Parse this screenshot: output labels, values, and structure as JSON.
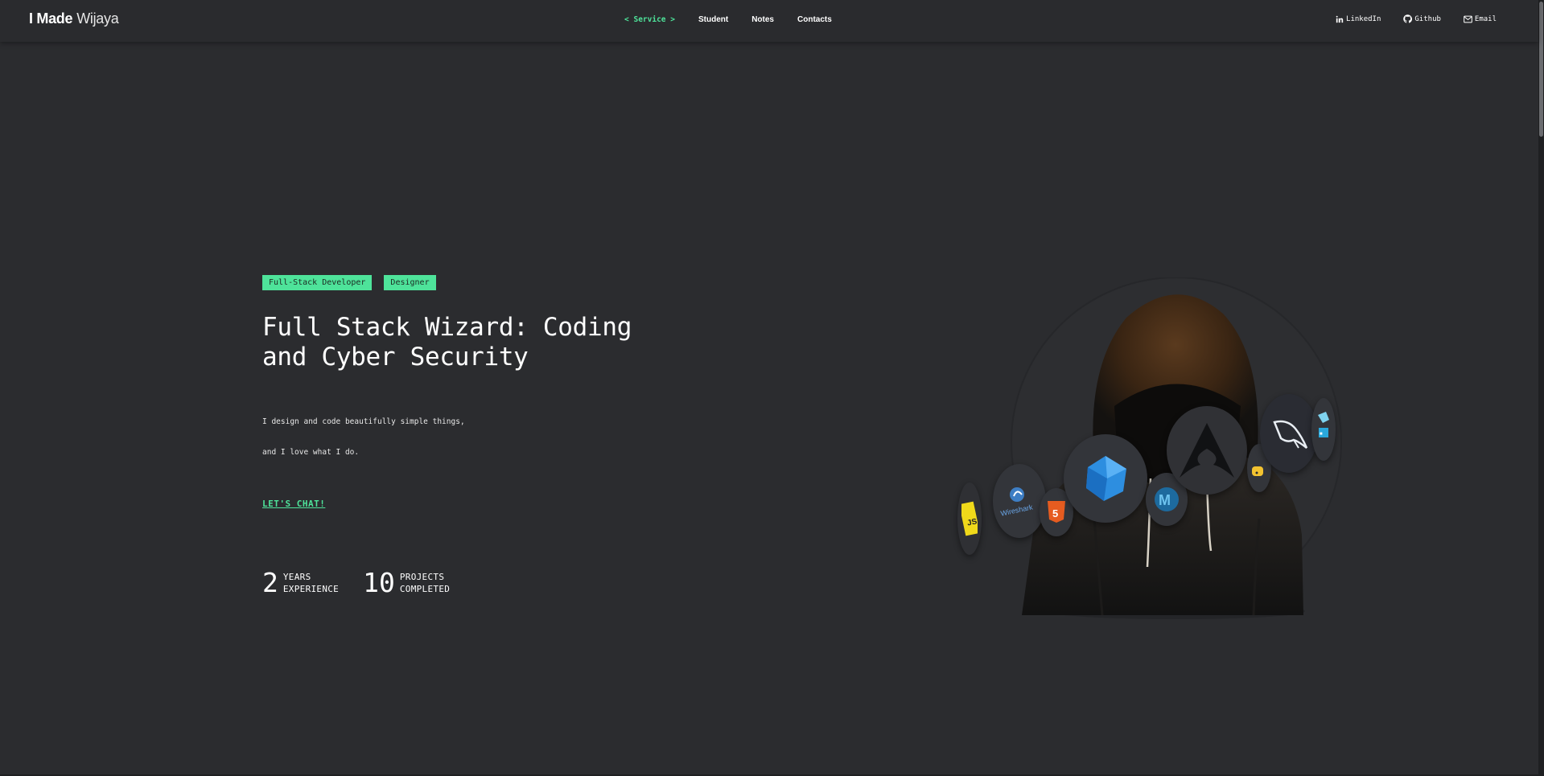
{
  "brand": {
    "first": "I Made",
    "last": "Wijaya"
  },
  "nav": {
    "active": {
      "prefix": "<",
      "label": "Service",
      "suffix": ">"
    },
    "links": [
      "Student",
      "Notes",
      "Contacts"
    ]
  },
  "social": [
    {
      "label": "LinkedIn",
      "icon": "linkedin-icon"
    },
    {
      "label": "Github",
      "icon": "github-icon"
    },
    {
      "label": "Email",
      "icon": "email-icon"
    }
  ],
  "hero": {
    "tags": [
      "Full-Stack Developer",
      "Designer"
    ],
    "title": "Full Stack Wizard: Coding and Cyber Security",
    "description_line1": "I design and code beautifully simple things,",
    "description_line2": "and I love what I do.",
    "cta": "LET'S CHAT!",
    "stats": [
      {
        "number": "2",
        "label1": "YEARS",
        "label2": "EXPERIENCE"
      },
      {
        "number": "10",
        "label1": "PROJECTS",
        "label2": "COMPLETED"
      }
    ]
  },
  "illustration": {
    "tech_logos": [
      "JS",
      "Wireshark",
      "HTML5",
      "Dart",
      "Metasploit",
      "Arch Linux",
      "MySQL",
      "Python",
      "Docker"
    ]
  },
  "colors": {
    "background": "#2b2c2f",
    "accent": "#4ee39a",
    "navbar": "#2a2b2e"
  }
}
